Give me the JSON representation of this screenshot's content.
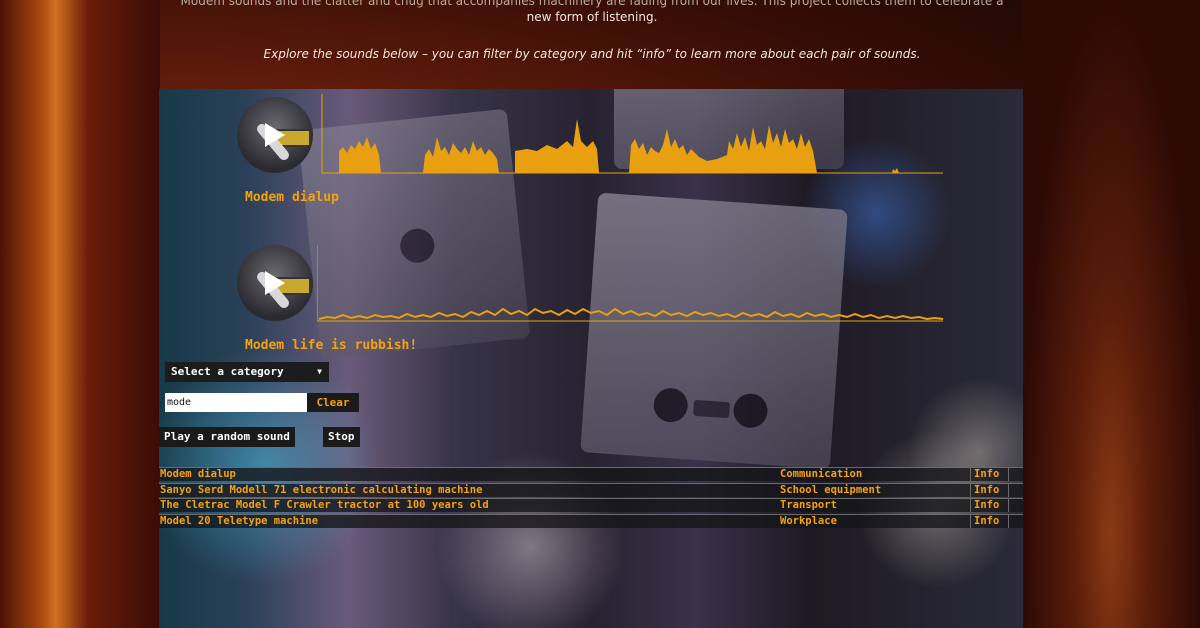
{
  "intro": {
    "line1": "Modem sounds and the clatter and chug that accompanies machinery are fading from our lives. This project collects them to celebrate a",
    "line2": "new form of listening.",
    "line3": "Explore the sounds below – you can filter by category and hit “info” to learn more about each pair of sounds."
  },
  "sounds": [
    {
      "title": "Modem dialup"
    },
    {
      "title": "Modem life is rubbish!"
    }
  ],
  "controls": {
    "category_select": "Select a category",
    "search_value": "mode",
    "clear_label": "Clear",
    "random_label": "Play a random sound",
    "stop_label": "Stop"
  },
  "table": {
    "rows": [
      {
        "name": "Modem dialup",
        "category": "Communication",
        "info": "Info"
      },
      {
        "name": "Sanyo Serd Modell 71 electronic calculating machine",
        "category": "School equipment",
        "info": "Info"
      },
      {
        "name": "The Cletrac Model F Crawler tractor at 100 years old",
        "category": "Transport",
        "info": "Info"
      },
      {
        "name": "Model 20 Teletype machine",
        "category": "Workplace",
        "info": "Info"
      }
    ]
  },
  "colors": {
    "accent": "#f5a20a",
    "waveform": "#e8a010"
  },
  "icons": {
    "play": "play-icon",
    "caret": "caret-down-icon"
  }
}
